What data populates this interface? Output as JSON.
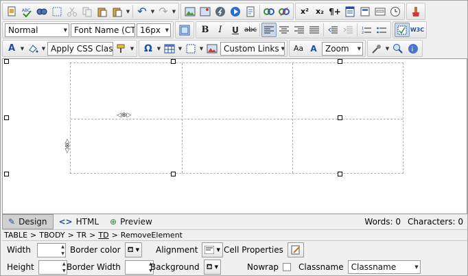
{
  "toolbar1": {
    "icons": [
      "cut-icon",
      "copy-icon",
      "paste-icon",
      "undo-icon",
      "redo-icon"
    ],
    "undo_label": "↶",
    "redo_label": "↷"
  },
  "toolbar2": {
    "format": "Normal",
    "font": "Font Name (CT",
    "size": "16px",
    "bold": "B",
    "italic": "I",
    "underline": "U",
    "strike": "abc"
  },
  "toolbar3": {
    "css_class": "Apply CSS Clas",
    "links": "Custom Links",
    "zoom": "Zoom",
    "omega": "Ω",
    "validator": "W3C"
  },
  "mode_bar": {
    "design": "Design",
    "html": "HTML",
    "preview": "Preview",
    "words": "Words: 0",
    "characters": "Characters: 0"
  },
  "path": {
    "table": "TABLE",
    "tbody": "TBODY",
    "tr": "TR",
    "td": "TD",
    "remove": "RemoveElement",
    "sep": ">"
  },
  "properties": {
    "width": "Width",
    "height": "Height",
    "border_color": "Border color",
    "border_width": "Border Width",
    "alignment": "Alignment",
    "background": "Background",
    "cell_properties": "Cell Properties",
    "nowrap": "Nowrap",
    "classname_label": "Classname",
    "classname_value": "Classname"
  }
}
